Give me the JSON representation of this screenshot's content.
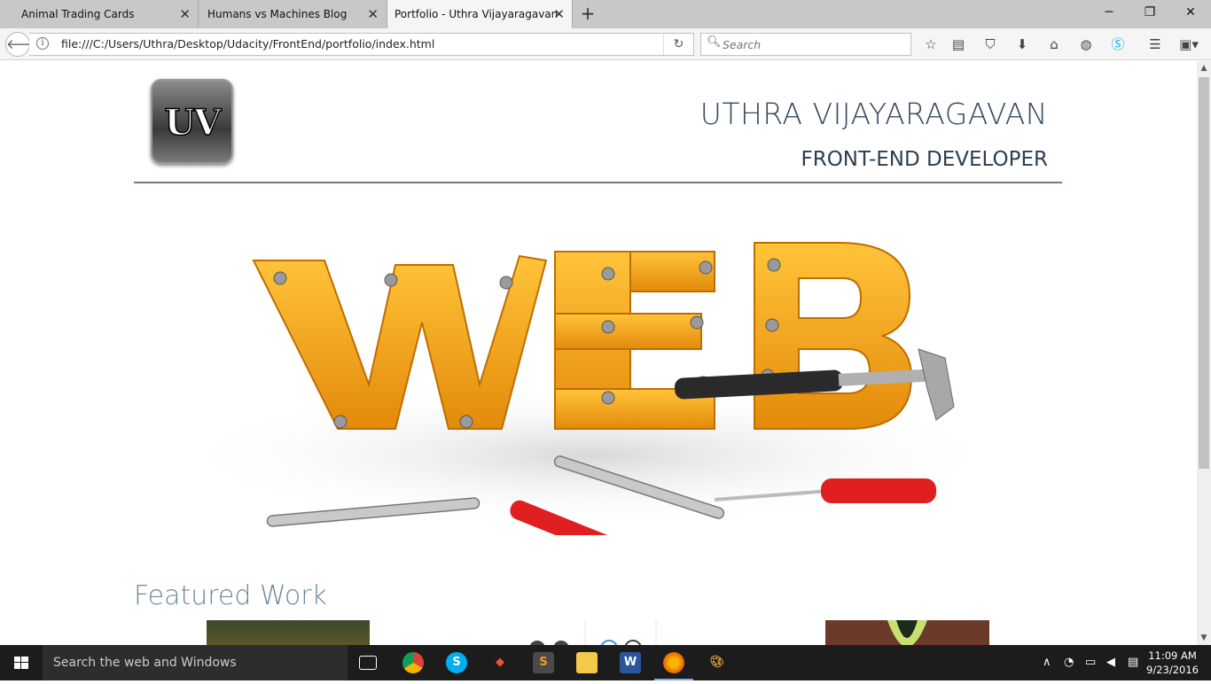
{
  "browser": {
    "tabs": [
      {
        "label": "Animal Trading Cards"
      },
      {
        "label": "Humans vs Machines Blog"
      },
      {
        "label": "Portfolio - Uthra Vijayaragavan"
      }
    ],
    "url": "file:///C:/Users/Uthra/Desktop/Udacity/FrontEnd/portfolio/index.html",
    "search_placeholder": "Search"
  },
  "page": {
    "logo_text": "UV",
    "name": "UTHRA VIJAYARAGAVAN",
    "role": "FRONT-END DEVELOPER",
    "hero_word": "WEB",
    "featured_heading": "Featured Work"
  },
  "taskbar": {
    "search_placeholder": "Search the web and Windows",
    "time": "11:09 AM",
    "date": "9/23/2016"
  },
  "colors": {
    "accent_rule": "#6c7a89",
    "heading": "#34495e",
    "featured": "#6c8a9b",
    "web_orange": "#f5a623"
  }
}
